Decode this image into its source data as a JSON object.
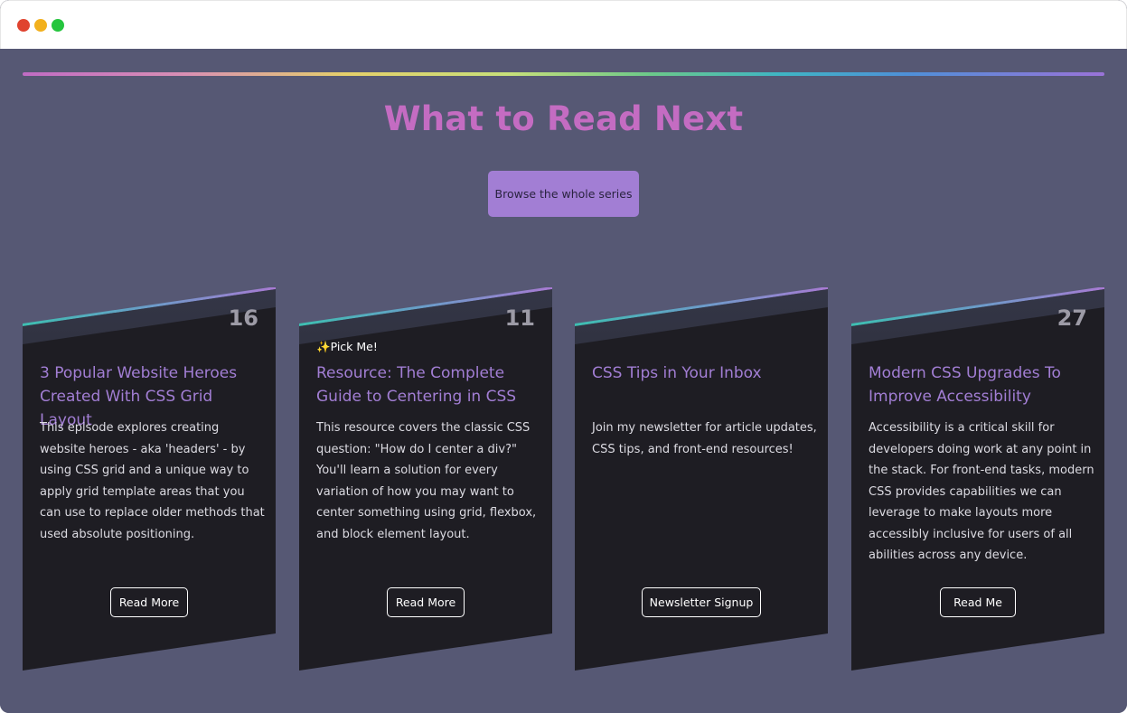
{
  "window": {
    "controls": [
      "close",
      "minimize",
      "maximize"
    ]
  },
  "page": {
    "heading": "What to Read Next",
    "browse_label": "Browse the whole series"
  },
  "colors": {
    "background": "#565874",
    "heading": "#c46cc2",
    "accent": "#a27ed4",
    "card": "#1e1d23"
  },
  "cards": [
    {
      "number": "16",
      "badge": "",
      "title": "3 Popular Website Heroes Created With CSS Grid Layout",
      "description": "This episode explores creating website heroes - aka 'headers' - by using CSS grid and a unique way to apply grid template areas that you can use to replace older methods that used absolute positioning.",
      "button": "Read More"
    },
    {
      "number": "11",
      "badge": "✨Pick Me!",
      "title": "Resource: The Complete Guide to Centering in CSS",
      "description": "This resource covers the classic CSS question: \"How do I center a div?\" You'll learn a solution for every variation of how you may want to center something using grid, flexbox, and block element layout.",
      "button": "Read More"
    },
    {
      "number": "",
      "badge": "",
      "title": "CSS Tips in Your Inbox",
      "description": "Join my newsletter for article updates, CSS tips, and front-end resources!",
      "button": "Newsletter Signup"
    },
    {
      "number": "27",
      "badge": "",
      "title": "Modern CSS Upgrades To Improve Accessibility",
      "description": "Accessibility is a critical skill for developers doing work at any point in the stack. For front-end tasks, modern CSS provides capabilities we can leverage to make layouts more accessibly inclusive for users of all abilities across any device.",
      "button": "Read Me"
    }
  ]
}
